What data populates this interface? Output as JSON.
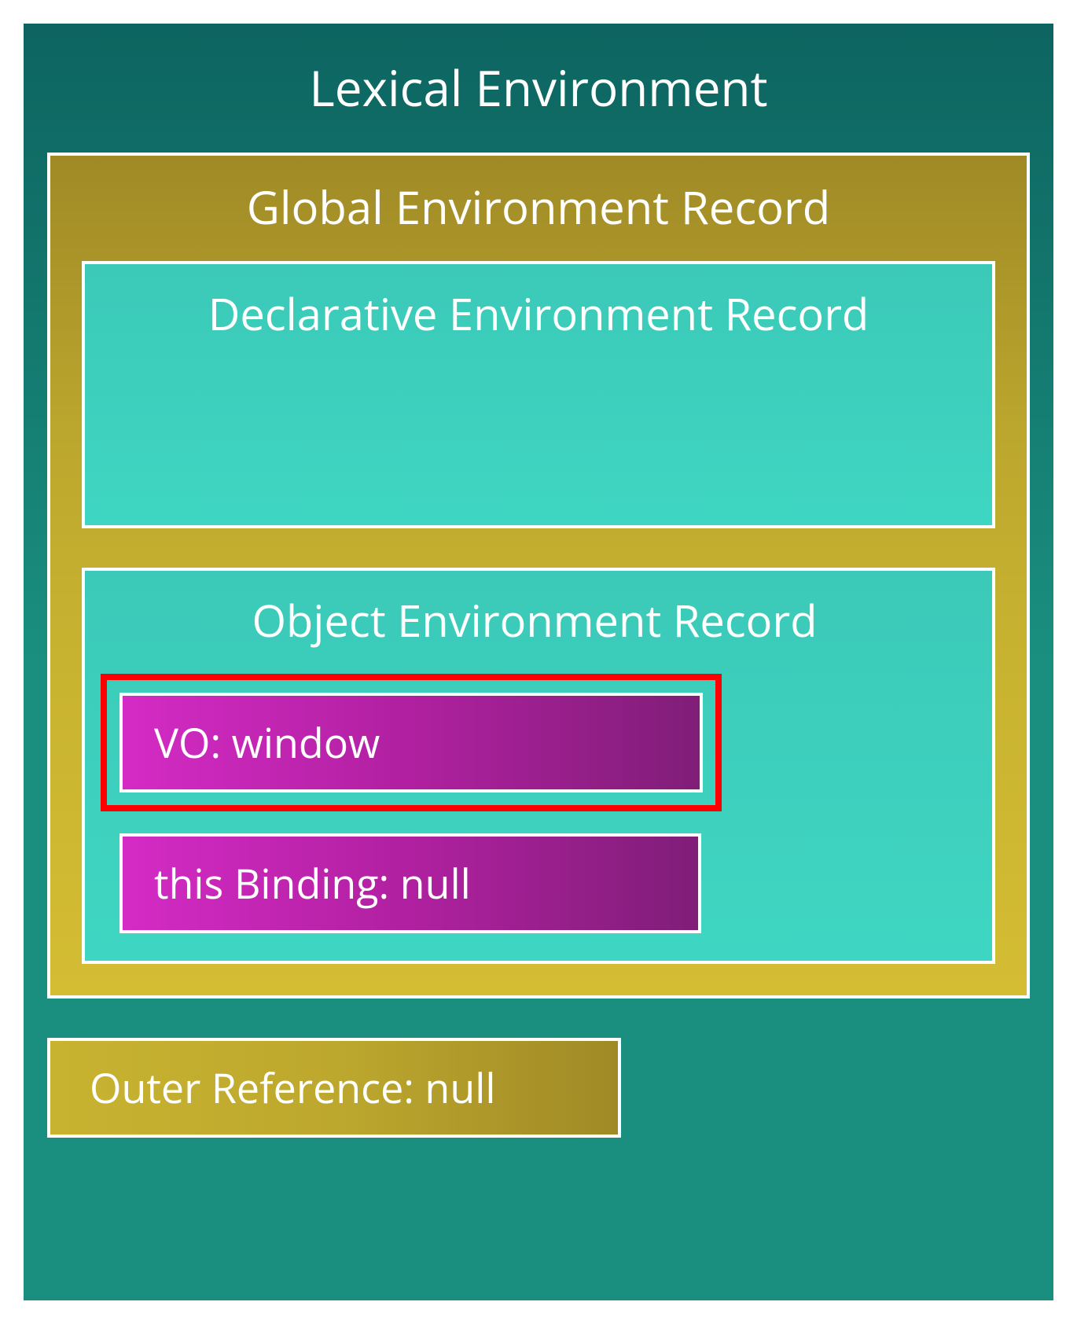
{
  "lexical_environment": {
    "title": "Lexical Environment",
    "global_record": {
      "title": "Global Environment Record",
      "declarative_record": {
        "title": "Declarative Environment Record"
      },
      "object_record": {
        "title": "Object Environment Record",
        "vo": "VO: window",
        "this_binding": "this Binding: null"
      }
    },
    "outer_reference": "Outer Reference: null"
  }
}
